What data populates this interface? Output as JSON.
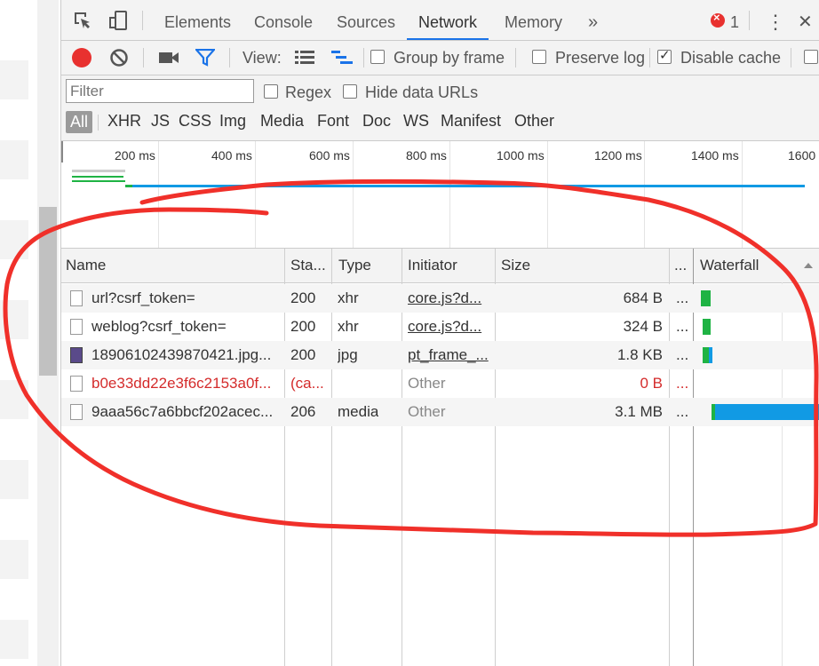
{
  "tabs": {
    "elements": "Elements",
    "console": "Console",
    "sources": "Sources",
    "network": "Network",
    "memory": "Memory",
    "more": "»",
    "error_count": "1",
    "menu": "⋮",
    "close": "✕"
  },
  "toolbar": {
    "view_label": "View:",
    "group_by_frame": "Group by frame",
    "group_by_frame_checked": false,
    "preserve_log": "Preserve log",
    "preserve_log_checked": false,
    "disable_cache": "Disable cache",
    "disable_cache_checked": true
  },
  "filter": {
    "placeholder": "Filter",
    "regex": "Regex",
    "hide_data_urls": "Hide data URLs",
    "types": [
      "All",
      "XHR",
      "JS",
      "CSS",
      "Img",
      "Media",
      "Font",
      "Doc",
      "WS",
      "Manifest",
      "Other"
    ],
    "active_type": "All"
  },
  "overview": {
    "ticks": [
      "200 ms",
      "400 ms",
      "600 ms",
      "800 ms",
      "1000 ms",
      "1200 ms",
      "1400 ms",
      "1600"
    ]
  },
  "table": {
    "headers": {
      "name": "Name",
      "status": "Sta...",
      "type": "Type",
      "initiator": "Initiator",
      "size": "Size",
      "more": "...",
      "waterfall": "Waterfall"
    },
    "rows": [
      {
        "name": "url?csrf_token=",
        "status": "200",
        "type": "xhr",
        "initiator": "core.js?d...",
        "size": "684 B",
        "more": "...",
        "icon": "document-icon"
      },
      {
        "name": "weblog?csrf_token=",
        "status": "200",
        "type": "xhr",
        "initiator": "core.js?d...",
        "size": "324 B",
        "more": "...",
        "icon": "document-icon"
      },
      {
        "name": "18906102439870421.jpg...",
        "status": "200",
        "type": "jpg",
        "initiator": "pt_frame_...",
        "size": "1.8 KB",
        "more": "...",
        "icon": "image-icon"
      },
      {
        "name": "b0e33dd22e3f6c2153a0f...",
        "status": "(ca...",
        "type": "",
        "initiator": "Other",
        "size": "0 B",
        "more": "...",
        "icon": "document-icon",
        "error": true
      },
      {
        "name": "9aaa56c7a6bbcf202acec...",
        "status": "206",
        "type": "media",
        "initiator": "Other",
        "size": "3.1 MB",
        "more": "...",
        "icon": "document-icon"
      }
    ]
  },
  "colors": {
    "record": "#e8312f",
    "accent": "#1a73e8",
    "waterfall_waiting": "#1fb344",
    "waterfall_download": "#119ae4",
    "error_text": "#d42b2b",
    "annotation": "#f0302a"
  }
}
